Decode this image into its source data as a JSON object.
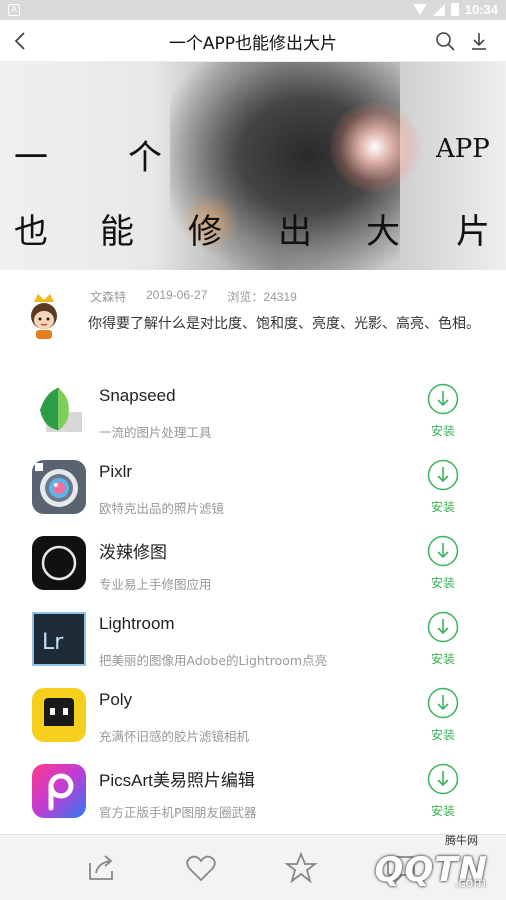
{
  "status_bar": {
    "time": "10:34"
  },
  "header": {
    "title": "一个APP也能修出大片"
  },
  "banner": {
    "line1": [
      "一",
      "个",
      "APP"
    ],
    "line2": [
      "也",
      "能",
      "修",
      "出",
      "大",
      "片"
    ]
  },
  "article": {
    "author": "文森特",
    "date": "2019-06-27",
    "views": "浏览：24319",
    "description": "你得要了解什么是对比度、饱和度、亮度、光影、高亮、色相。"
  },
  "apps": [
    {
      "name": "Snapseed",
      "subtitle": "一流的图片处理工具",
      "install_label": "安装",
      "icon": "snapseed-icon"
    },
    {
      "name": "Pixlr",
      "subtitle": "欧特克出品的照片滤镜",
      "install_label": "安装",
      "icon": "pixlr-icon"
    },
    {
      "name": "泼辣修图",
      "subtitle": "专业易上手修图应用",
      "install_label": "安装",
      "icon": "polarr-icon"
    },
    {
      "name": "Lightroom",
      "subtitle": "把美丽的图像用Adobe的Lightroom点亮",
      "install_label": "安装",
      "icon": "lightroom-icon"
    },
    {
      "name": "Poly",
      "subtitle": "充满怀旧感的胶片滤镜相机",
      "install_label": "安装",
      "icon": "poly-icon"
    },
    {
      "name": "PicsArt美易照片编辑",
      "subtitle": "官方正版手机P图朋友圈武器",
      "install_label": "安装",
      "icon": "picsart-icon"
    }
  ],
  "bottom_bar": {
    "icons": [
      "share-icon",
      "heart-icon",
      "star-icon",
      "comment-icon"
    ]
  },
  "watermark": {
    "tag": "腾牛网",
    "logo": "QQTN",
    "suffix": ".com"
  },
  "colors": {
    "accent_green": "#3cb25a"
  }
}
